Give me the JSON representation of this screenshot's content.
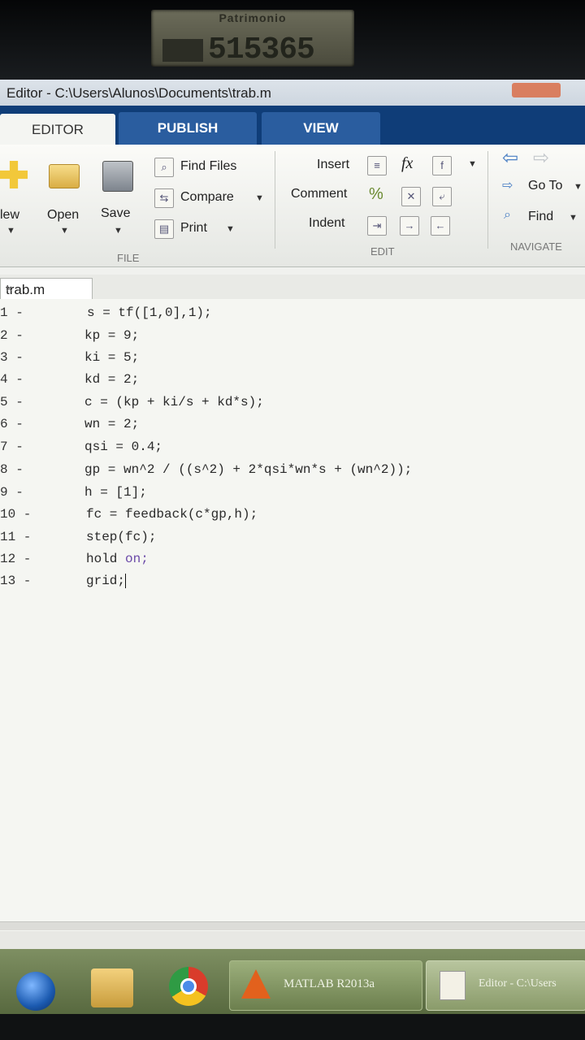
{
  "asset_tag": {
    "label": "Patrimonio",
    "number": "515365"
  },
  "window": {
    "title": "Editor - C:\\Users\\Alunos\\Documents\\trab.m"
  },
  "tabs": [
    {
      "label": "EDITOR"
    },
    {
      "label": "PUBLISH"
    },
    {
      "label": "VIEW"
    }
  ],
  "ribbon": {
    "file": {
      "new_label": "lew",
      "open_label": "Open",
      "save_label": "Save",
      "find_files_label": "Find Files",
      "compare_label": "Compare",
      "print_label": "Print",
      "group_label": "FILE"
    },
    "edit": {
      "insert_label": "Insert",
      "comment_label": "Comment",
      "indent_label": "Indent",
      "fx_label": "fx",
      "percent_label": "%",
      "group_label": "EDIT"
    },
    "navigate": {
      "goto_label": "Go To",
      "find_label": "Find",
      "group_label": "NAVIGATE"
    }
  },
  "document_tab": {
    "label": "trab.m",
    "close": "×"
  },
  "code": {
    "gutter": [
      "1 -",
      "2 -",
      "3 -",
      "4 -",
      "5 -",
      "6 -",
      "7 -",
      "8 -",
      "9 -",
      "10 -",
      "11 -",
      "12 -",
      "13 -"
    ],
    "lines": [
      "s = tf([1,0],1);",
      "kp = 9;",
      "ki = 5;",
      "kd = 2;",
      "c = (kp + ki/s + kd*s);",
      "wn = 2;",
      "qsi = 0.4;",
      "gp = wn^2 / ((s^2) + 2*qsi*wn*s + (wn^2));",
      "h = [1];",
      "fc = feedback(c*gp,h);",
      "step(fc);",
      "hold ",
      "grid;"
    ],
    "line12_keyword": "on;"
  },
  "taskbar": {
    "matlab_label": "MATLAB R2013a",
    "editor_label": "Editor - C:\\Users"
  }
}
